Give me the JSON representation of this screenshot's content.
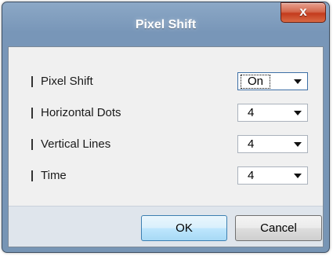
{
  "window": {
    "title": "Pixel Shift",
    "close_label": "x"
  },
  "settings": [
    {
      "label": "Pixel Shift",
      "value": "On"
    },
    {
      "label": "Horizontal Dots",
      "value": "4"
    },
    {
      "label": "Vertical Lines",
      "value": "4"
    },
    {
      "label": "Time",
      "value": "4"
    }
  ],
  "buttons": {
    "ok": "OK",
    "cancel": "Cancel"
  },
  "colors": {
    "frame": "#7896b8",
    "close_button": "#c43b1d",
    "client_bg": "#f0f0f0",
    "default_button": "#bee6fd"
  }
}
